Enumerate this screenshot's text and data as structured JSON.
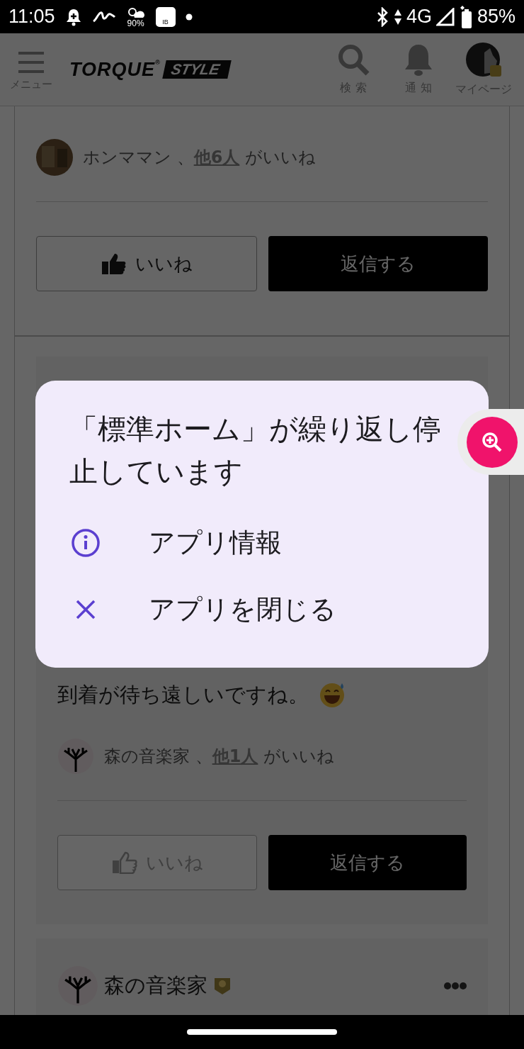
{
  "status_bar": {
    "time": "11:05",
    "weather_percent": "90%",
    "bank_badge": "IB",
    "network": "4G",
    "battery": "85%"
  },
  "header": {
    "menu_label": "メニュー",
    "logo": {
      "word": "TORQUE",
      "mark": "®",
      "tag": "STYLE"
    },
    "nav": [
      {
        "kind": "search",
        "label": "検 索"
      },
      {
        "kind": "bell",
        "label": "通 知"
      },
      {
        "kind": "avatar",
        "label": "マイページ"
      }
    ]
  },
  "posts": [
    {
      "likes": {
        "names": "ホンママン",
        "separator": "、",
        "link": "他6人",
        "suffix": "がいいね"
      },
      "like_button": {
        "label": "いいね",
        "liked": true
      },
      "reply_button": "返信する"
    },
    {
      "body": "到着が待ち遠しいですね。",
      "likes": {
        "names": "森の音楽家",
        "separator": "、",
        "link": "他1人",
        "suffix": "がいいね"
      },
      "like_button": {
        "label": "いいね",
        "liked": false
      },
      "reply_button": "返信する"
    }
  ],
  "next_post": {
    "author": "森の音楽家"
  },
  "dialog": {
    "title": "「標準ホーム」が繰り返し停止しています",
    "options": [
      {
        "kind": "info",
        "label": "アプリ情報"
      },
      {
        "kind": "close",
        "label": "アプリを閉じる"
      }
    ]
  }
}
